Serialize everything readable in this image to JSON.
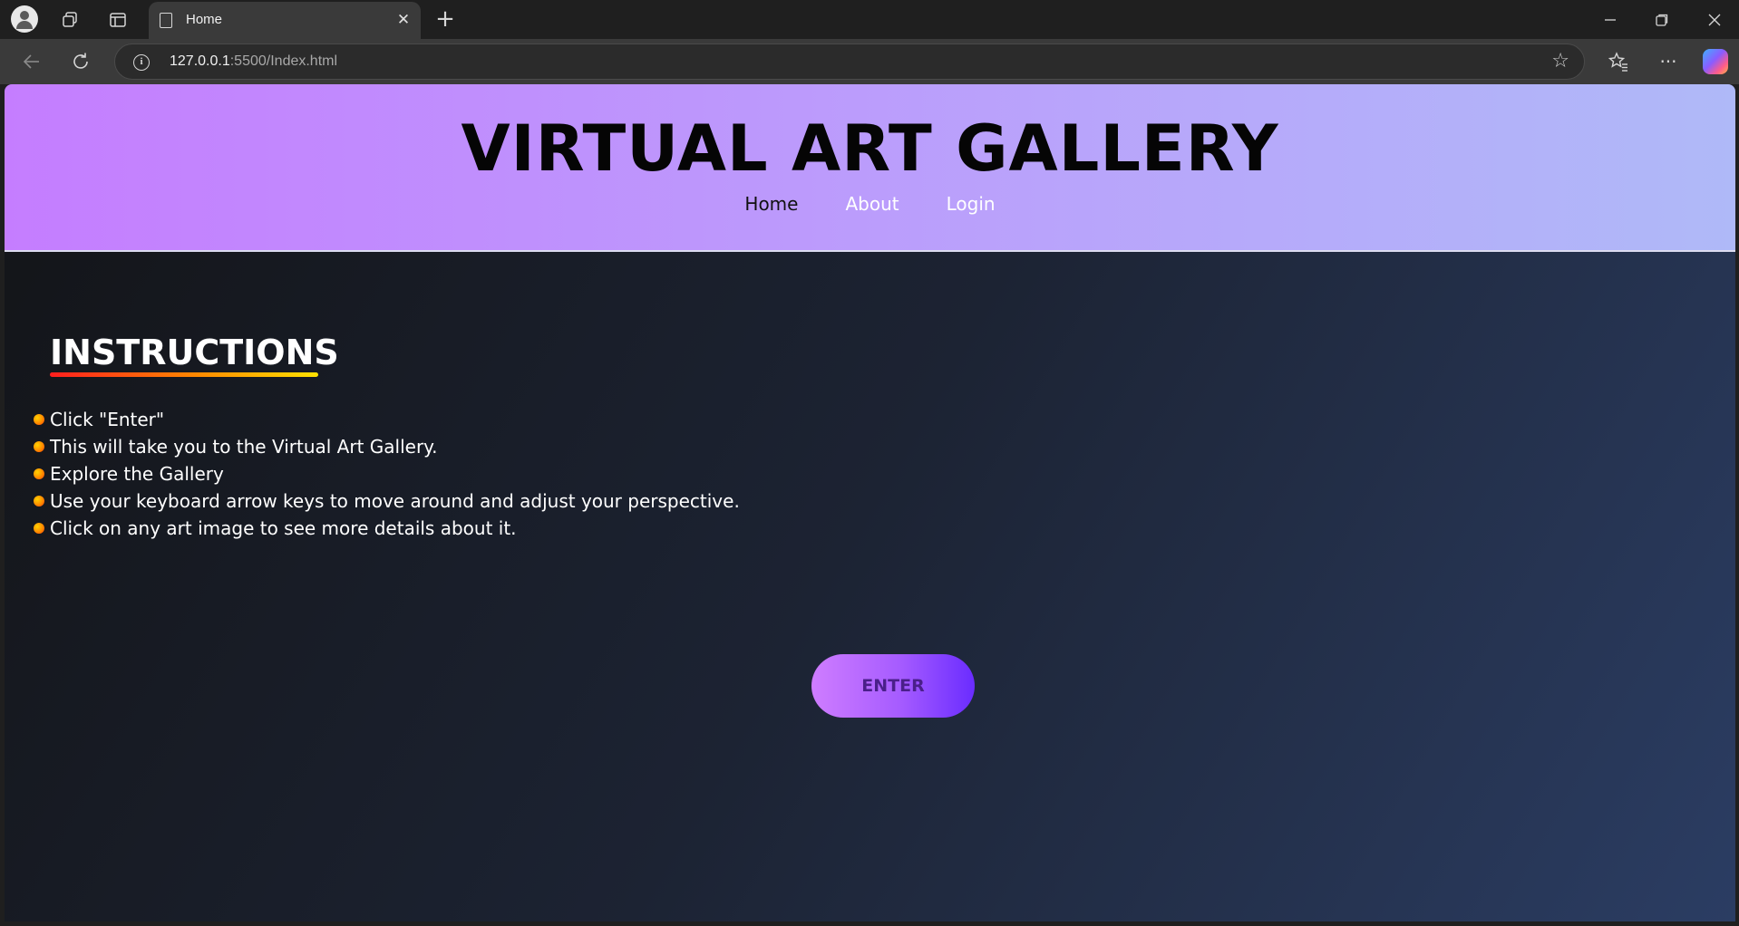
{
  "browser": {
    "tab_title": "Home",
    "url_host": "127.0.0.1",
    "url_rest": ":5500/Index.html"
  },
  "site": {
    "title": "VIRTUAL ART GALLERY",
    "nav": [
      "Home",
      "About",
      "Login"
    ]
  },
  "instructions": {
    "heading": "INSTRUCTIONS",
    "items": [
      "Click \"Enter\"",
      "This will take you to the Virtual Art Gallery.",
      "Explore the Gallery",
      "Use your keyboard arrow keys to move around and adjust your perspective.",
      "Click on any art image to see more details about it."
    ]
  },
  "enter_button": "ENTER",
  "colors": {
    "header_start": "#c57dff",
    "header_end": "#afb9f8",
    "button_start": "#cf7dff",
    "button_end": "#6a2cff"
  },
  "icons": {
    "profile": "profile-icon",
    "workspaces": "workspaces-icon",
    "tab_actions": "tab-actions-icon",
    "tab_page": "page-icon",
    "close_tab": "close-icon",
    "new_tab": "plus-icon",
    "minimize": "minimize-icon",
    "restore": "restore-icon",
    "close_window": "close-icon",
    "back": "back-arrow-icon",
    "refresh": "refresh-icon",
    "info": "info-icon",
    "favorite": "star-icon",
    "favorites": "favorites-icon",
    "more": "more-icon",
    "copilot": "copilot-icon"
  }
}
